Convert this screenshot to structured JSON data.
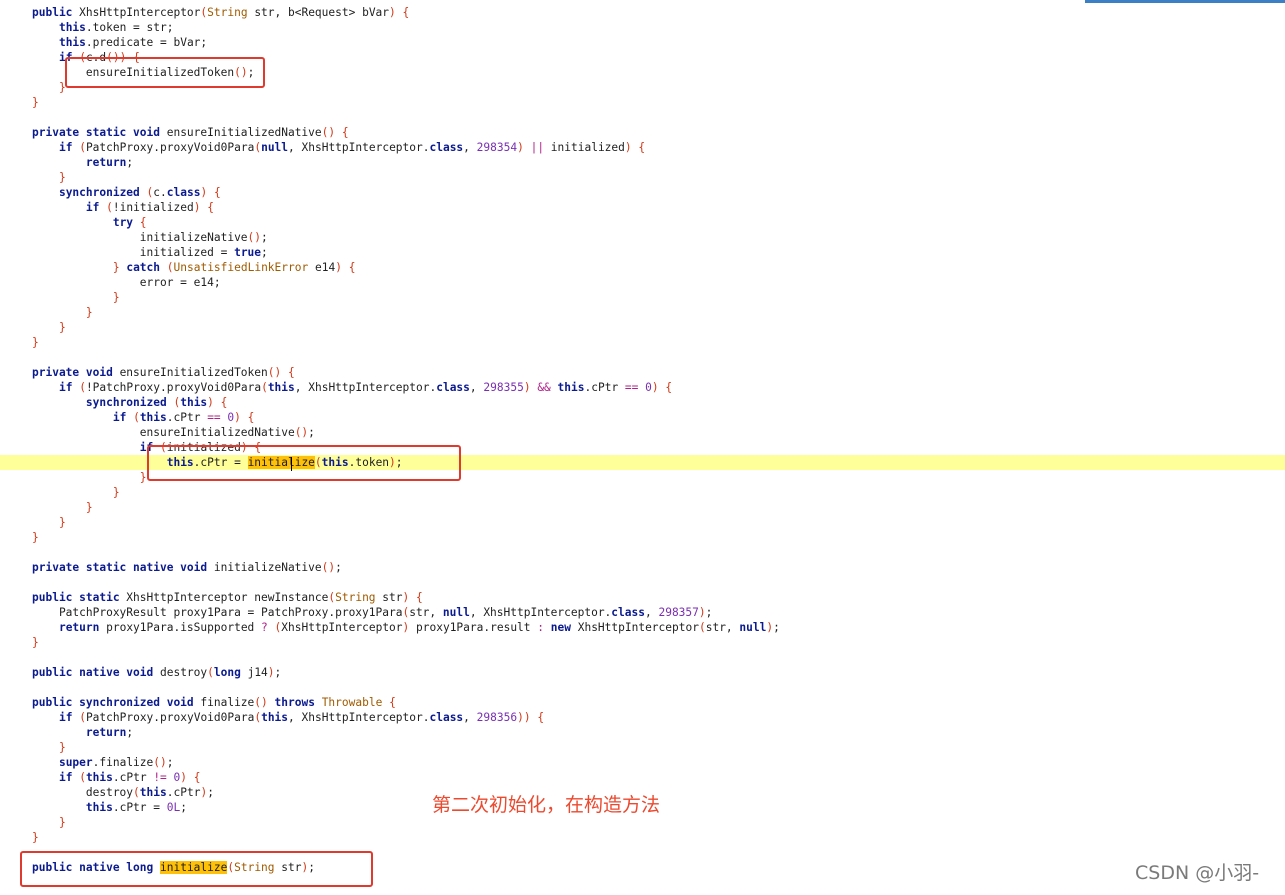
{
  "code_lines": [
    [
      {
        "t": "public",
        "c": "kw"
      },
      {
        "t": " XhsHttpInterceptor"
      },
      {
        "t": "(",
        "c": "br"
      },
      {
        "t": "String",
        "c": "ty"
      },
      {
        "t": " str, b<Request> bVar"
      },
      {
        "t": ")",
        "c": "br"
      },
      {
        "t": " "
      },
      {
        "t": "{",
        "c": "br"
      }
    ],
    [
      {
        "t": "    "
      },
      {
        "t": "this",
        "c": "kw"
      },
      {
        "t": ".token = str;"
      }
    ],
    [
      {
        "t": "    "
      },
      {
        "t": "this",
        "c": "kw"
      },
      {
        "t": ".predicate = bVar;"
      }
    ],
    [
      {
        "t": "    "
      },
      {
        "t": "if",
        "c": "kw"
      },
      {
        "t": " "
      },
      {
        "t": "(",
        "c": "br"
      },
      {
        "t": "c.d"
      },
      {
        "t": "()) {",
        "c": "br"
      }
    ],
    [
      {
        "t": "        ensureInitializedToken"
      },
      {
        "t": "()",
        "c": "br"
      },
      {
        "t": ";"
      }
    ],
    [
      {
        "t": "    "
      },
      {
        "t": "}",
        "c": "br"
      }
    ],
    [
      {
        "t": "}",
        "c": "br"
      }
    ],
    [],
    [
      {
        "t": "private static void",
        "c": "kw"
      },
      {
        "t": " ensureInitializedNative"
      },
      {
        "t": "()",
        "c": "br"
      },
      {
        "t": " "
      },
      {
        "t": "{",
        "c": "br"
      }
    ],
    [
      {
        "t": "    "
      },
      {
        "t": "if",
        "c": "kw"
      },
      {
        "t": " "
      },
      {
        "t": "(",
        "c": "br"
      },
      {
        "t": "PatchProxy.proxyVoid0Para"
      },
      {
        "t": "(",
        "c": "br"
      },
      {
        "t": "null",
        "c": "kw"
      },
      {
        "t": ", XhsHttpInterceptor."
      },
      {
        "t": "class",
        "c": "kw"
      },
      {
        "t": ", "
      },
      {
        "t": "298354",
        "c": "num"
      },
      {
        "t": ")",
        "c": "br"
      },
      {
        "t": " "
      },
      {
        "t": "||",
        "c": "op"
      },
      {
        "t": " initialized"
      },
      {
        "t": ")",
        "c": "br"
      },
      {
        "t": " "
      },
      {
        "t": "{",
        "c": "br"
      }
    ],
    [
      {
        "t": "        "
      },
      {
        "t": "return",
        "c": "kw"
      },
      {
        "t": ";"
      }
    ],
    [
      {
        "t": "    "
      },
      {
        "t": "}",
        "c": "br"
      }
    ],
    [
      {
        "t": "    "
      },
      {
        "t": "synchronized",
        "c": "kw"
      },
      {
        "t": " "
      },
      {
        "t": "(",
        "c": "br"
      },
      {
        "t": "c."
      },
      {
        "t": "class",
        "c": "kw"
      },
      {
        "t": ")",
        "c": "br"
      },
      {
        "t": " "
      },
      {
        "t": "{",
        "c": "br"
      }
    ],
    [
      {
        "t": "        "
      },
      {
        "t": "if",
        "c": "kw"
      },
      {
        "t": " "
      },
      {
        "t": "(",
        "c": "br"
      },
      {
        "t": "!initialized"
      },
      {
        "t": ")",
        "c": "br"
      },
      {
        "t": " "
      },
      {
        "t": "{",
        "c": "br"
      }
    ],
    [
      {
        "t": "            "
      },
      {
        "t": "try",
        "c": "kw"
      },
      {
        "t": " "
      },
      {
        "t": "{",
        "c": "br"
      }
    ],
    [
      {
        "t": "                initializeNative"
      },
      {
        "t": "()",
        "c": "br"
      },
      {
        "t": ";"
      }
    ],
    [
      {
        "t": "                initialized = "
      },
      {
        "t": "true",
        "c": "kw"
      },
      {
        "t": ";"
      }
    ],
    [
      {
        "t": "            "
      },
      {
        "t": "}",
        "c": "br"
      },
      {
        "t": " "
      },
      {
        "t": "catch",
        "c": "kw"
      },
      {
        "t": " "
      },
      {
        "t": "(",
        "c": "br"
      },
      {
        "t": "UnsatisfiedLinkError",
        "c": "ty"
      },
      {
        "t": " e14"
      },
      {
        "t": ")",
        "c": "br"
      },
      {
        "t": " "
      },
      {
        "t": "{",
        "c": "br"
      }
    ],
    [
      {
        "t": "                error = e14;"
      }
    ],
    [
      {
        "t": "            "
      },
      {
        "t": "}",
        "c": "br"
      }
    ],
    [
      {
        "t": "        "
      },
      {
        "t": "}",
        "c": "br"
      }
    ],
    [
      {
        "t": "    "
      },
      {
        "t": "}",
        "c": "br"
      }
    ],
    [
      {
        "t": "}",
        "c": "br"
      }
    ],
    [],
    [
      {
        "t": "private void",
        "c": "kw"
      },
      {
        "t": " ensureInitializedToken"
      },
      {
        "t": "()",
        "c": "br"
      },
      {
        "t": " "
      },
      {
        "t": "{",
        "c": "br"
      }
    ],
    [
      {
        "t": "    "
      },
      {
        "t": "if",
        "c": "kw"
      },
      {
        "t": " "
      },
      {
        "t": "(",
        "c": "br"
      },
      {
        "t": "!PatchProxy.proxyVoid0Para"
      },
      {
        "t": "(",
        "c": "br"
      },
      {
        "t": "this",
        "c": "kw"
      },
      {
        "t": ", XhsHttpInterceptor."
      },
      {
        "t": "class",
        "c": "kw"
      },
      {
        "t": ", "
      },
      {
        "t": "298355",
        "c": "num"
      },
      {
        "t": ")",
        "c": "br"
      },
      {
        "t": " "
      },
      {
        "t": "&&",
        "c": "op"
      },
      {
        "t": " "
      },
      {
        "t": "this",
        "c": "kw"
      },
      {
        "t": ".cPtr "
      },
      {
        "t": "==",
        "c": "op"
      },
      {
        "t": " "
      },
      {
        "t": "0",
        "c": "num"
      },
      {
        "t": ")",
        "c": "br"
      },
      {
        "t": " "
      },
      {
        "t": "{",
        "c": "br"
      }
    ],
    [
      {
        "t": "        "
      },
      {
        "t": "synchronized",
        "c": "kw"
      },
      {
        "t": " "
      },
      {
        "t": "(",
        "c": "br"
      },
      {
        "t": "this",
        "c": "kw"
      },
      {
        "t": ")",
        "c": "br"
      },
      {
        "t": " "
      },
      {
        "t": "{",
        "c": "br"
      }
    ],
    [
      {
        "t": "            "
      },
      {
        "t": "if",
        "c": "kw"
      },
      {
        "t": " "
      },
      {
        "t": "(",
        "c": "br"
      },
      {
        "t": "this",
        "c": "kw"
      },
      {
        "t": ".cPtr "
      },
      {
        "t": "==",
        "c": "op"
      },
      {
        "t": " "
      },
      {
        "t": "0",
        "c": "num"
      },
      {
        "t": ")",
        "c": "br"
      },
      {
        "t": " "
      },
      {
        "t": "{",
        "c": "br"
      }
    ],
    [
      {
        "t": "                ensureInitializedNative"
      },
      {
        "t": "()",
        "c": "br"
      },
      {
        "t": ";"
      }
    ],
    [
      {
        "t": "                "
      },
      {
        "t": "if",
        "c": "kw"
      },
      {
        "t": " "
      },
      {
        "t": "(",
        "c": "br"
      },
      {
        "t": "initialized"
      },
      {
        "t": ")",
        "c": "br"
      },
      {
        "t": " "
      },
      {
        "t": "{",
        "c": "br"
      }
    ],
    [
      {
        "t": "                    "
      },
      {
        "t": "this",
        "c": "kw"
      },
      {
        "t": ".cPtr = "
      },
      {
        "t": "initialize",
        "c": "mk"
      },
      {
        "t": "(",
        "c": "br"
      },
      {
        "t": "this",
        "c": "kw"
      },
      {
        "t": ".token"
      },
      {
        "t": ")",
        "c": "br"
      },
      {
        "t": ";"
      }
    ],
    [
      {
        "t": "                "
      },
      {
        "t": "}",
        "c": "br"
      }
    ],
    [
      {
        "t": "            "
      },
      {
        "t": "}",
        "c": "br"
      }
    ],
    [
      {
        "t": "        "
      },
      {
        "t": "}",
        "c": "br"
      }
    ],
    [
      {
        "t": "    "
      },
      {
        "t": "}",
        "c": "br"
      }
    ],
    [
      {
        "t": "}",
        "c": "br"
      }
    ],
    [],
    [
      {
        "t": "private static native void",
        "c": "kw"
      },
      {
        "t": " initializeNative"
      },
      {
        "t": "()",
        "c": "br"
      },
      {
        "t": ";"
      }
    ],
    [],
    [
      {
        "t": "public static",
        "c": "kw"
      },
      {
        "t": " XhsHttpInterceptor newInstance"
      },
      {
        "t": "(",
        "c": "br"
      },
      {
        "t": "String",
        "c": "ty"
      },
      {
        "t": " str"
      },
      {
        "t": ")",
        "c": "br"
      },
      {
        "t": " "
      },
      {
        "t": "{",
        "c": "br"
      }
    ],
    [
      {
        "t": "    PatchProxyResult proxy1Para = PatchProxy.proxy1Para"
      },
      {
        "t": "(",
        "c": "br"
      },
      {
        "t": "str, "
      },
      {
        "t": "null",
        "c": "kw"
      },
      {
        "t": ", XhsHttpInterceptor."
      },
      {
        "t": "class",
        "c": "kw"
      },
      {
        "t": ", "
      },
      {
        "t": "298357",
        "c": "num"
      },
      {
        "t": ")",
        "c": "br"
      },
      {
        "t": ";"
      }
    ],
    [
      {
        "t": "    "
      },
      {
        "t": "return",
        "c": "kw"
      },
      {
        "t": " proxy1Para.isSupported "
      },
      {
        "t": "?",
        "c": "op"
      },
      {
        "t": " "
      },
      {
        "t": "(",
        "c": "br"
      },
      {
        "t": "XhsHttpInterceptor"
      },
      {
        "t": ")",
        "c": "br"
      },
      {
        "t": " proxy1Para.result "
      },
      {
        "t": ":",
        "c": "op"
      },
      {
        "t": " "
      },
      {
        "t": "new",
        "c": "kw"
      },
      {
        "t": " XhsHttpInterceptor"
      },
      {
        "t": "(",
        "c": "br"
      },
      {
        "t": "str, "
      },
      {
        "t": "null",
        "c": "kw"
      },
      {
        "t": ")",
        "c": "br"
      },
      {
        "t": ";"
      }
    ],
    [
      {
        "t": "}",
        "c": "br"
      }
    ],
    [],
    [
      {
        "t": "public native void",
        "c": "kw"
      },
      {
        "t": " destroy"
      },
      {
        "t": "(",
        "c": "br"
      },
      {
        "t": "long",
        "c": "kw"
      },
      {
        "t": " j14"
      },
      {
        "t": ")",
        "c": "br"
      },
      {
        "t": ";"
      }
    ],
    [],
    [
      {
        "t": "public synchronized void",
        "c": "kw"
      },
      {
        "t": " finalize"
      },
      {
        "t": "()",
        "c": "br"
      },
      {
        "t": " "
      },
      {
        "t": "throws",
        "c": "kw"
      },
      {
        "t": " "
      },
      {
        "t": "Throwable",
        "c": "ty"
      },
      {
        "t": " "
      },
      {
        "t": "{",
        "c": "br"
      }
    ],
    [
      {
        "t": "    "
      },
      {
        "t": "if",
        "c": "kw"
      },
      {
        "t": " "
      },
      {
        "t": "(",
        "c": "br"
      },
      {
        "t": "PatchProxy.proxyVoid0Para"
      },
      {
        "t": "(",
        "c": "br"
      },
      {
        "t": "this",
        "c": "kw"
      },
      {
        "t": ", XhsHttpInterceptor."
      },
      {
        "t": "class",
        "c": "kw"
      },
      {
        "t": ", "
      },
      {
        "t": "298356",
        "c": "num"
      },
      {
        "t": "))",
        "c": "br"
      },
      {
        "t": " "
      },
      {
        "t": "{",
        "c": "br"
      }
    ],
    [
      {
        "t": "        "
      },
      {
        "t": "return",
        "c": "kw"
      },
      {
        "t": ";"
      }
    ],
    [
      {
        "t": "    "
      },
      {
        "t": "}",
        "c": "br"
      }
    ],
    [
      {
        "t": "    "
      },
      {
        "t": "super",
        "c": "kw"
      },
      {
        "t": ".finalize"
      },
      {
        "t": "()",
        "c": "br"
      },
      {
        "t": ";"
      }
    ],
    [
      {
        "t": "    "
      },
      {
        "t": "if",
        "c": "kw"
      },
      {
        "t": " "
      },
      {
        "t": "(",
        "c": "br"
      },
      {
        "t": "this",
        "c": "kw"
      },
      {
        "t": ".cPtr "
      },
      {
        "t": "!=",
        "c": "op"
      },
      {
        "t": " "
      },
      {
        "t": "0",
        "c": "num"
      },
      {
        "t": ")",
        "c": "br"
      },
      {
        "t": " "
      },
      {
        "t": "{",
        "c": "br"
      }
    ],
    [
      {
        "t": "        destroy"
      },
      {
        "t": "(",
        "c": "br"
      },
      {
        "t": "this",
        "c": "kw"
      },
      {
        "t": ".cPtr"
      },
      {
        "t": ")",
        "c": "br"
      },
      {
        "t": ";"
      }
    ],
    [
      {
        "t": "        "
      },
      {
        "t": "this",
        "c": "kw"
      },
      {
        "t": ".cPtr = "
      },
      {
        "t": "0L",
        "c": "num"
      },
      {
        "t": ";"
      }
    ],
    [
      {
        "t": "    "
      },
      {
        "t": "}",
        "c": "br"
      }
    ],
    [
      {
        "t": "}",
        "c": "br"
      }
    ],
    [],
    [
      {
        "t": "public native long",
        "c": "kw"
      },
      {
        "t": " "
      },
      {
        "t": "initialize",
        "c": "mk"
      },
      {
        "t": "(",
        "c": "br"
      },
      {
        "t": "String",
        "c": "ty"
      },
      {
        "t": " str"
      },
      {
        "t": ")",
        "c": "br"
      },
      {
        "t": ";"
      }
    ]
  ],
  "highlighted_line_index": 30,
  "annotation": "第二次初始化，在构造方法",
  "watermark": "CSDN @小羽-",
  "colors": {
    "keyword": "#0b1b8f",
    "type": "#a05a00",
    "number": "#7a2fb2",
    "bracket": "#d23a1a",
    "match_highlight": "#ffc107",
    "line_highlight": "#ffff99",
    "annotation_box": "#e03a2e"
  }
}
